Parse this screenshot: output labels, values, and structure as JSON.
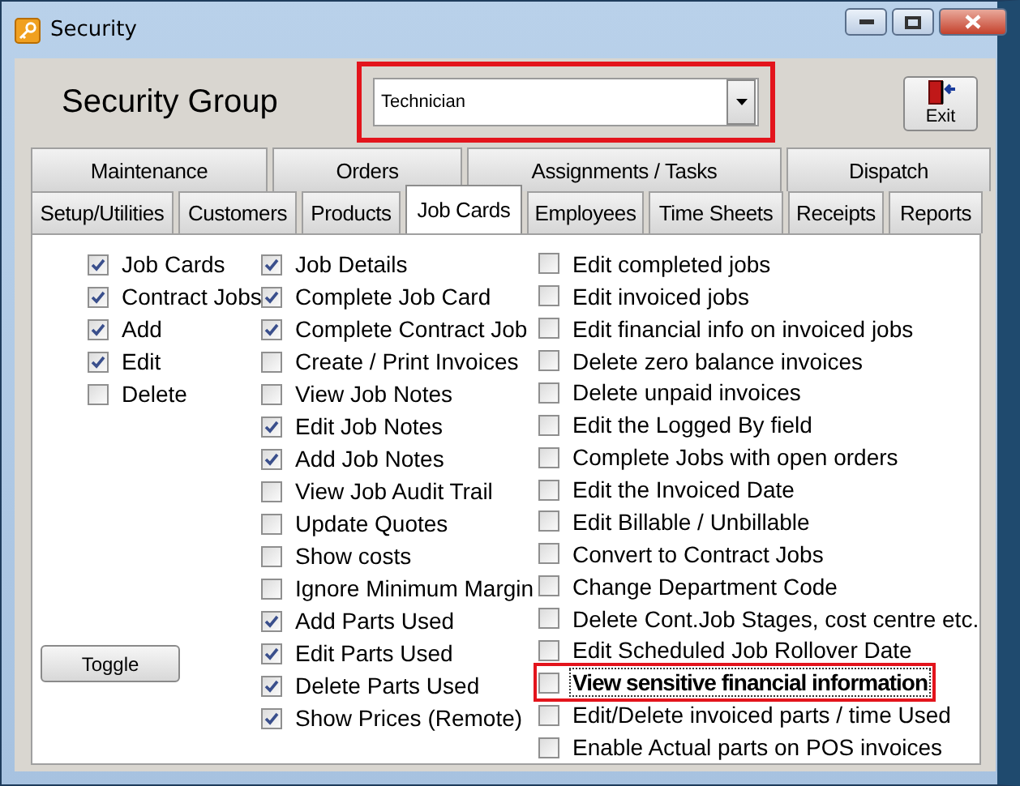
{
  "window": {
    "title": "Security"
  },
  "header": {
    "label": "Security Group",
    "group_select": {
      "value": "Technician",
      "highlighted": true
    },
    "exit_button": "Exit"
  },
  "tabs_row_1": [
    {
      "label": "Maintenance",
      "selected": false
    },
    {
      "label": "Orders",
      "selected": false
    },
    {
      "label": "Assignments / Tasks",
      "selected": false
    },
    {
      "label": "Dispatch",
      "selected": false
    }
  ],
  "tabs_row_2": [
    {
      "label": "Setup/Utilities",
      "selected": false
    },
    {
      "label": "Customers",
      "selected": false
    },
    {
      "label": "Products",
      "selected": false
    },
    {
      "label": "Job Cards",
      "selected": true
    },
    {
      "label": "Employees",
      "selected": false
    },
    {
      "label": "Time Sheets",
      "selected": false
    },
    {
      "label": "Receipts",
      "selected": false
    },
    {
      "label": "Reports",
      "selected": false
    }
  ],
  "columns": [
    [
      {
        "label": "Job Cards",
        "checked": true
      },
      {
        "label": "Contract Jobs",
        "checked": true
      },
      {
        "label": "Add",
        "checked": true
      },
      {
        "label": "Edit",
        "checked": true
      },
      {
        "label": "Delete",
        "checked": false
      }
    ],
    [
      {
        "label": "Job Details",
        "checked": true
      },
      {
        "label": "Complete Job Card",
        "checked": true
      },
      {
        "label": "Complete Contract Job",
        "checked": true
      },
      {
        "label": "Create / Print Invoices",
        "checked": false
      },
      {
        "label": "View Job Notes",
        "checked": false
      },
      {
        "label": "Edit Job Notes",
        "checked": true
      },
      {
        "label": "Add Job Notes",
        "checked": true
      },
      {
        "label": "View Job Audit Trail",
        "checked": false
      },
      {
        "label": "Update Quotes",
        "checked": false
      },
      {
        "label": "Show costs",
        "checked": false
      },
      {
        "label": "Ignore Minimum Margin",
        "checked": false
      },
      {
        "label": "Add Parts Used",
        "checked": true
      },
      {
        "label": "Edit Parts Used",
        "checked": true
      },
      {
        "label": "Delete Parts Used",
        "checked": true
      },
      {
        "label": "Show Prices (Remote)",
        "checked": true
      }
    ],
    [
      {
        "label": "Edit completed jobs",
        "checked": false
      },
      {
        "label": "Edit invoiced jobs",
        "checked": false
      },
      {
        "label": "Edit financial info on invoiced jobs",
        "checked": false
      },
      {
        "label": "Delete zero balance invoices",
        "checked": false
      },
      {
        "label": "Delete unpaid invoices",
        "checked": false
      },
      {
        "label": "Edit the Logged By field",
        "checked": false
      },
      {
        "label": "Complete Jobs with open orders",
        "checked": false
      },
      {
        "label": "Edit the Invoiced Date",
        "checked": false
      },
      {
        "label": "Edit Billable / Unbillable",
        "checked": false
      },
      {
        "label": "Convert to Contract Jobs",
        "checked": false
      },
      {
        "label": "Change Department Code",
        "checked": false
      },
      {
        "label": "Delete Cont.Job Stages, cost centre etc.",
        "checked": false
      },
      {
        "label": "Edit Scheduled Job Rollover Date",
        "checked": false
      },
      {
        "label": "View sensitive financial information",
        "checked": false,
        "focused": true,
        "highlighted": true
      },
      {
        "label": "Edit/Delete invoiced parts / time Used",
        "checked": false
      },
      {
        "label": "Enable Actual parts on POS invoices",
        "checked": false
      }
    ]
  ],
  "toggle_button": "Toggle"
}
